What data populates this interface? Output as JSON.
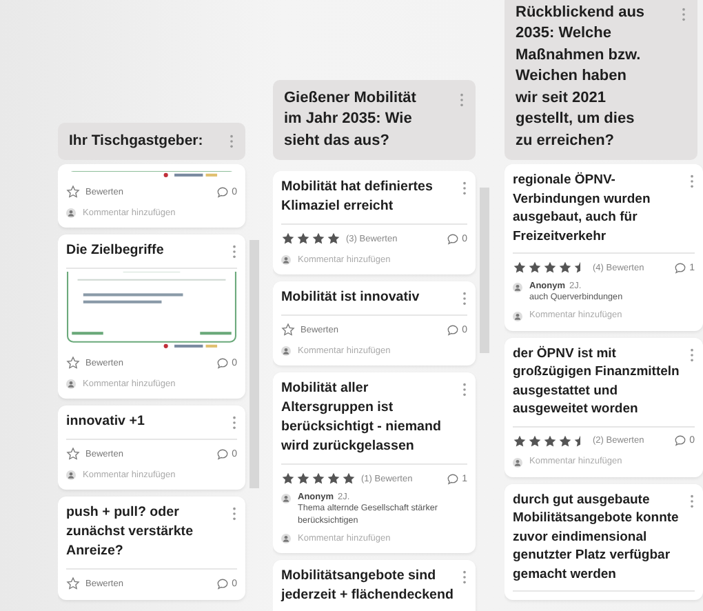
{
  "columns": [
    {
      "title": "Ihr Tischgastgeber:",
      "cards": [
        {
          "image": {
            "kind": "picture",
            "cut": true
          },
          "rating": {
            "label": "Bewerten"
          },
          "comment_count": "0",
          "add_comment": "Kommentar hinzufügen"
        },
        {
          "title": "Die Zielbegriffe",
          "image": {
            "kind": "picture",
            "cut": false
          },
          "rating": {
            "label": "Bewerten"
          },
          "comment_count": "0",
          "add_comment": "Kommentar hinzufügen"
        },
        {
          "title": "innovativ +1",
          "rating": {
            "label": "Bewerten"
          },
          "comment_count": "0",
          "add_comment": "Kommentar hinzufügen"
        },
        {
          "title": "push + pull? oder zunächst verstärkte Anreize?",
          "rating": {
            "label": "Bewerten"
          },
          "comment_count": "0"
        }
      ]
    },
    {
      "title": "Gießener Mobilität im Jahr 2035: Wie sieht das aus?",
      "cards": [
        {
          "title": "Mobilität hat definiertes Klimaziel erreicht",
          "rating": {
            "stars": 4,
            "count": "(3)",
            "label": "Bewerten"
          },
          "comment_count": "0",
          "add_comment": "Kommentar hinzufügen"
        },
        {
          "title": "Mobilität ist innovativ",
          "rating": {
            "label": "Bewerten"
          },
          "comment_count": "0",
          "add_comment": "Kommentar hinzufügen"
        },
        {
          "title": "Mobilität aller Altersgruppen ist berücksichtigt - niemand wird zurückgelassen",
          "rating": {
            "stars": 5,
            "count": "(1)",
            "label": "Bewerten"
          },
          "comment_count": "1",
          "comments": [
            {
              "author": "Anonym",
              "age": "2J.",
              "text": "Thema alternde Gesellschaft stärker berücksichtigen"
            }
          ],
          "add_comment": "Kommentar hinzufügen"
        },
        {
          "title": "Mobilitätsangebote sind jederzeit + flächendeckend"
        }
      ]
    },
    {
      "title": "Rückblickend aus 2035: Welche Maßnahmen bzw. Weichen haben wir seit 2021 gestellt, um dies zu erreichen?",
      "cards": [
        {
          "title": "regionale ÖPNV-Verbindungen wurden ausgebaut, auch für Freizeitverkehr",
          "rating": {
            "stars": 4.5,
            "count": "(4)",
            "label": "Bewerten"
          },
          "comment_count": "1",
          "comments": [
            {
              "author": "Anonym",
              "age": "2J.",
              "text": "auch Querverbindungen"
            }
          ],
          "add_comment": "Kommentar hinzufügen"
        },
        {
          "title": "der ÖPNV ist mit großzügigen Finanzmitteln ausgestattet und ausgeweitet worden",
          "rating": {
            "stars": 4.5,
            "count": "(2)",
            "label": "Bewerten"
          },
          "comment_count": "0",
          "add_comment": "Kommentar hinzufügen"
        },
        {
          "title": "durch gut ausgebaute Mobilitätsangebote konnte zuvor eindimensional genutzter Platz verfügbar gemacht werden"
        }
      ]
    }
  ]
}
